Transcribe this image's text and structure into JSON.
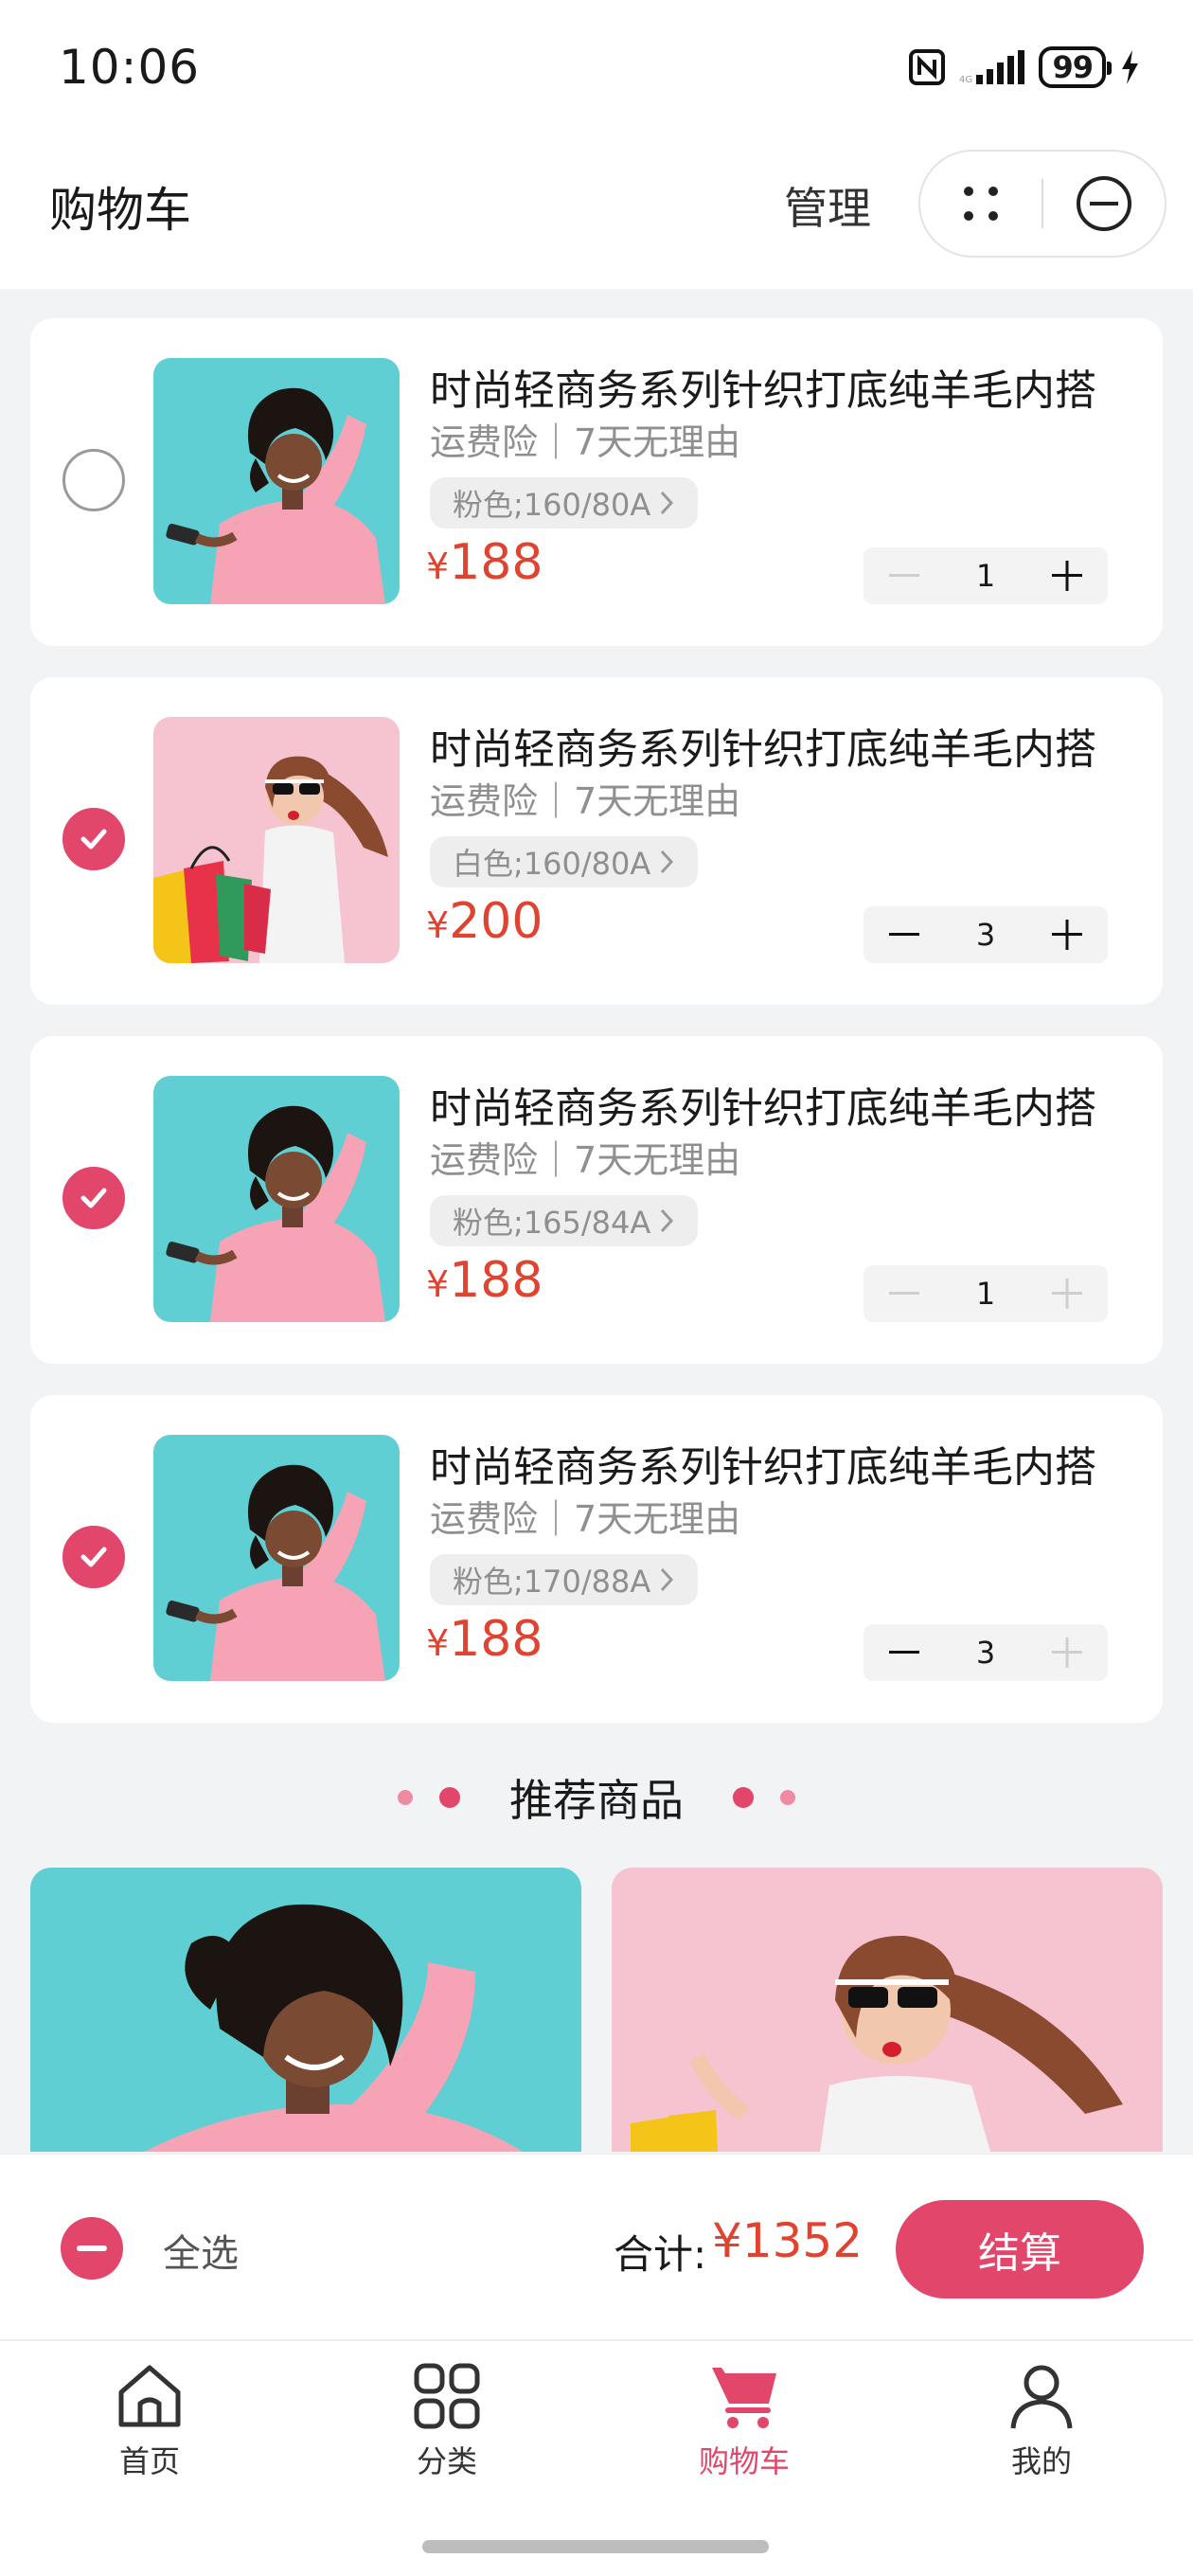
{
  "status_bar": {
    "time": "10:06",
    "battery": "99"
  },
  "header": {
    "title": "购物车",
    "manage_label": "管理"
  },
  "cart_items": [
    {
      "title": "时尚轻商务系列针织打底纯羊毛内搭",
      "service": "运费险｜7天无理由",
      "spec": "粉色;160/80A",
      "currency": "¥",
      "price": "188",
      "quantity": "1",
      "checked": false,
      "image": "teal-pink-sweater"
    },
    {
      "title": "时尚轻商务系列针织打底纯羊毛内搭",
      "service": "运费险｜7天无理由",
      "spec": "白色;160/80A",
      "currency": "¥",
      "price": "200",
      "quantity": "3",
      "checked": true,
      "image": "pink-shopping-bags"
    },
    {
      "title": "时尚轻商务系列针织打底纯羊毛内搭",
      "service": "运费险｜7天无理由",
      "spec": "粉色;165/84A",
      "currency": "¥",
      "price": "188",
      "quantity": "1",
      "checked": true,
      "image": "teal-pink-sweater"
    },
    {
      "title": "时尚轻商务系列针织打底纯羊毛内搭",
      "service": "运费险｜7天无理由",
      "spec": "粉色;170/88A",
      "currency": "¥",
      "price": "188",
      "quantity": "3",
      "checked": true,
      "image": "teal-pink-sweater"
    }
  ],
  "recommend": {
    "title": "推荐商品"
  },
  "checkout": {
    "select_all_label": "全选",
    "total_label": "合计:",
    "total_amount": "¥1352",
    "button_label": "结算"
  },
  "tabs": [
    {
      "label": "首页",
      "icon": "home-icon"
    },
    {
      "label": "分类",
      "icon": "grid-icon"
    },
    {
      "label": "购物车",
      "icon": "cart-icon",
      "active": true
    },
    {
      "label": "我的",
      "icon": "user-icon"
    }
  ],
  "colors": {
    "accent": "#e2466b",
    "price": "#e0432f",
    "teal": "#5fcfd4",
    "pink": "#f6c3d0"
  }
}
